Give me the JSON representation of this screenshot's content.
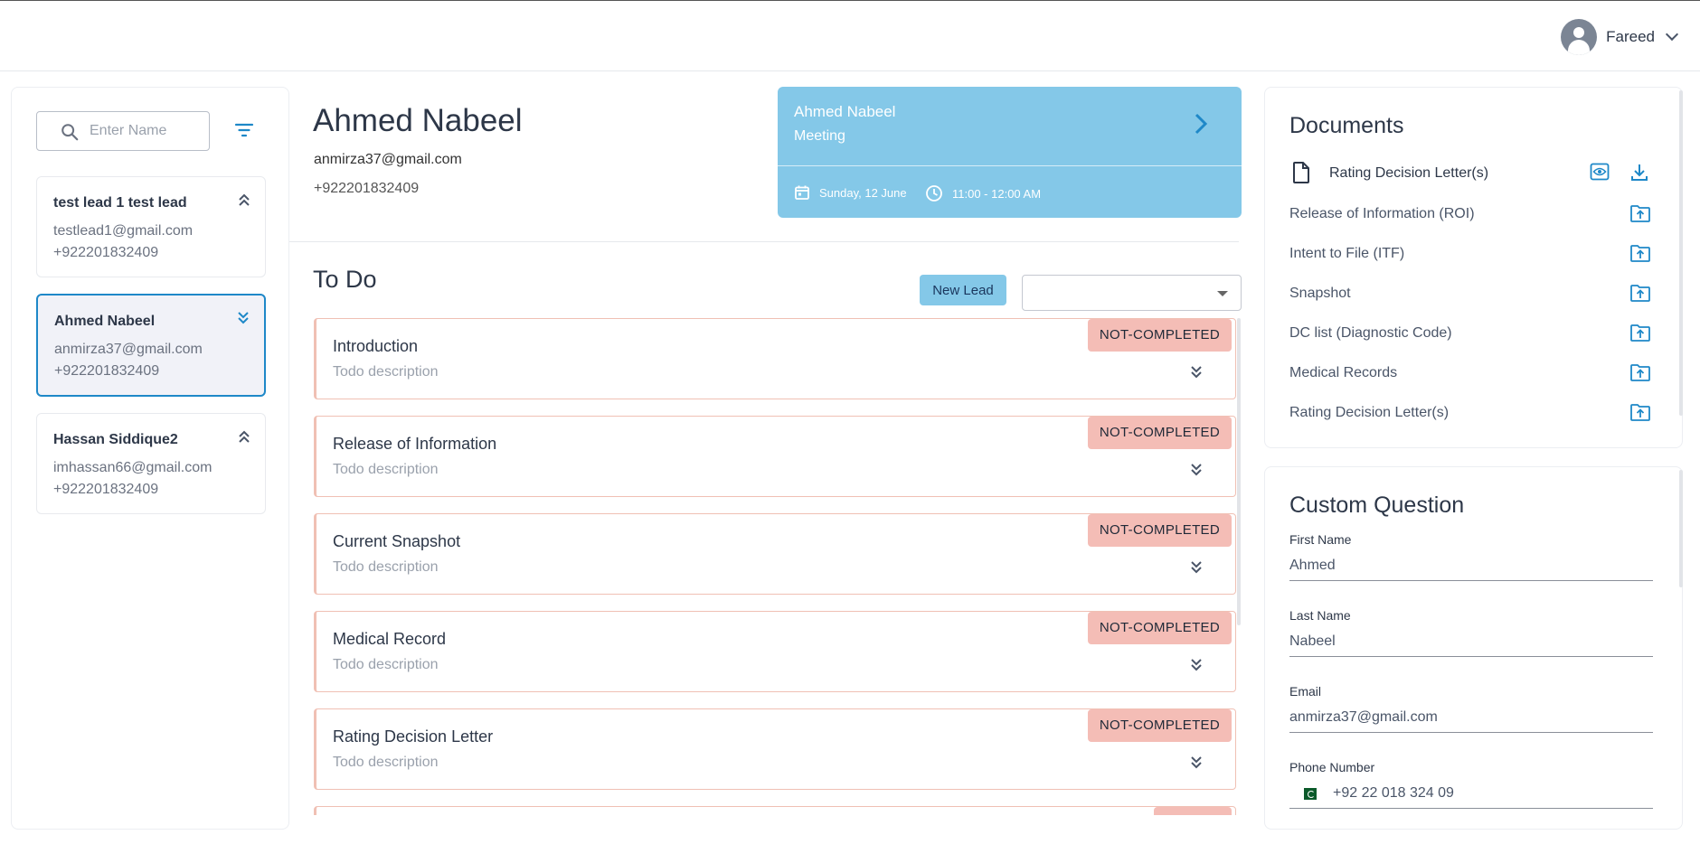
{
  "header": {
    "user_name": "Fareed"
  },
  "search": {
    "placeholder": "Enter Name"
  },
  "leads": [
    {
      "name": "test lead 1 test lead",
      "email": "testlead1@gmail.com",
      "phone": "+922201832409"
    },
    {
      "name": "Ahmed Nabeel",
      "email": "anmirza37@gmail.com",
      "phone": "+922201832409"
    },
    {
      "name": "Hassan Siddique2",
      "email": "imhassan66@gmail.com",
      "phone": "+922201832409"
    }
  ],
  "profile": {
    "name": "Ahmed Nabeel",
    "email": "anmirza37@gmail.com",
    "phone": "+922201832409"
  },
  "meeting": {
    "name": "Ahmed Nabeel",
    "type": "Meeting",
    "date": "Sunday, 12 June",
    "time": "11:00 - 12:00 AM"
  },
  "todo": {
    "title": "To Do",
    "new_lead_label": "New Lead",
    "items": [
      {
        "title": "Introduction",
        "description": "Todo description",
        "status": "NOT-COMPLETED"
      },
      {
        "title": "Release of Information",
        "description": "Todo description",
        "status": "NOT-COMPLETED"
      },
      {
        "title": "Current Snapshot",
        "description": "Todo description",
        "status": "NOT-COMPLETED"
      },
      {
        "title": "Medical Record",
        "description": "Todo description",
        "status": "NOT-COMPLETED"
      },
      {
        "title": "Rating Decision Letter",
        "description": "Todo description",
        "status": "NOT-COMPLETED"
      }
    ]
  },
  "documents": {
    "title": "Documents",
    "items": [
      {
        "label": "Rating Decision Letter(s)",
        "uploaded": true
      },
      {
        "label": "Release of Information (ROI)",
        "uploaded": false
      },
      {
        "label": "Intent to File (ITF)",
        "uploaded": false
      },
      {
        "label": "Snapshot",
        "uploaded": false
      },
      {
        "label": "DC list (Diagnostic Code)",
        "uploaded": false
      },
      {
        "label": "Medical Records",
        "uploaded": false
      },
      {
        "label": "Rating Decision Letter(s)",
        "uploaded": false
      }
    ]
  },
  "custom_question": {
    "title": "Custom Question",
    "fields": [
      {
        "label": "First Name",
        "value": "Ahmed"
      },
      {
        "label": "Last Name",
        "value": "Nabeel"
      },
      {
        "label": "Email",
        "value": "anmirza37@gmail.com"
      },
      {
        "label": "Phone Number",
        "value": "+92 22 018 324 09"
      }
    ]
  },
  "colors": {
    "accent": "#1e88c8",
    "meeting_bg": "#84c8e8",
    "badge_bg": "#f4bdb6",
    "todo_border": "#f0c0b4"
  }
}
